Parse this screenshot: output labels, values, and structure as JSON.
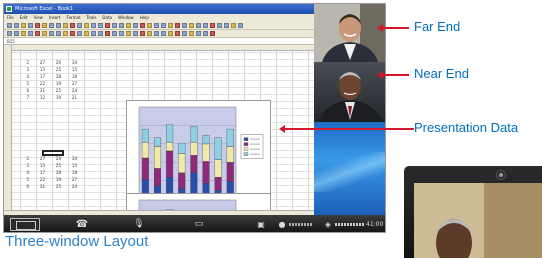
{
  "screen": {
    "window_title": "Microsoft Excel - Book1",
    "menu_items": [
      "File",
      "Edit",
      "View",
      "Insert",
      "Format",
      "Tools",
      "Data",
      "Window",
      "Help"
    ],
    "formula_cell": "B15",
    "sheet_rows_top": [
      [
        "2",
        "27",
        "20",
        "34"
      ],
      [
        "3",
        "13",
        "25",
        "15"
      ],
      [
        "4",
        "17",
        "28",
        "18"
      ],
      [
        "5",
        "22",
        "19",
        "27"
      ],
      [
        "6",
        "31",
        "25",
        "24"
      ],
      [
        "7",
        "12",
        "19",
        "21"
      ]
    ],
    "sheet_rows_bottom": [
      [
        "2",
        "27",
        "20",
        "34"
      ],
      [
        "3",
        "13",
        "25",
        "15"
      ],
      [
        "4",
        "17",
        "28",
        "18"
      ],
      [
        "5",
        "22",
        "19",
        "27"
      ],
      [
        "6",
        "31",
        "25",
        "24"
      ]
    ],
    "control_bar": {
      "time": "41:00"
    }
  },
  "callouts": {
    "far_end": "Far End",
    "near_end": "Near End",
    "presentation_data": "Presentation Data"
  },
  "caption": "Three-window Layout",
  "icons": [
    "layout-icon",
    "phone-icon",
    "mic-icon",
    "document-icon",
    "camera-icon",
    "network-icon"
  ],
  "colors": {
    "callout_line": "#d2182a",
    "callout_text": "#0070c0",
    "caption_text": "#2f82c8",
    "chart_series": [
      "#2a4fa8",
      "#8e2a78",
      "#f0e9a8",
      "#8ecfe3"
    ]
  }
}
